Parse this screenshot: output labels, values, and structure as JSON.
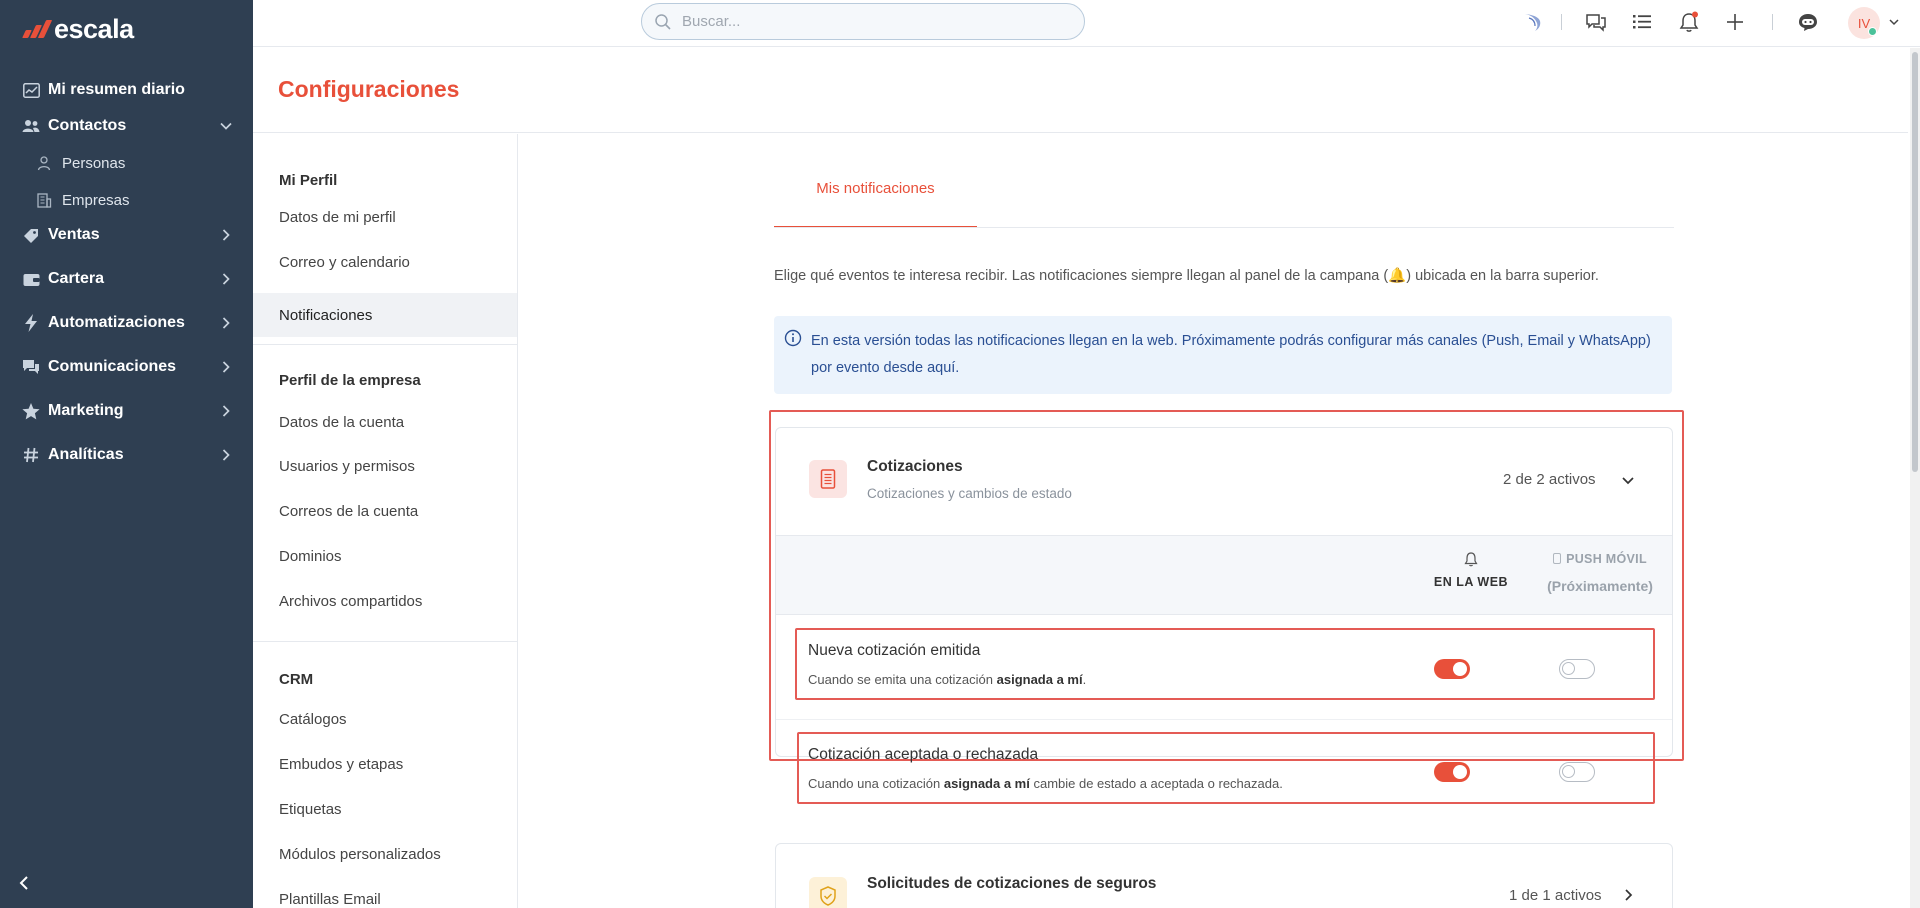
{
  "brand": {
    "name": "escala",
    "accent": "#e8503a",
    "sidebar_bg": "#2f3f52"
  },
  "sidebar": {
    "items": [
      {
        "label": "Mi resumen diario",
        "icon": "chart-line-icon"
      },
      {
        "label": "Contactos",
        "icon": "users-icon",
        "expanded": true,
        "children": [
          {
            "label": "Personas",
            "icon": "person-icon"
          },
          {
            "label": "Empresas",
            "icon": "building-icon"
          }
        ]
      },
      {
        "label": "Ventas",
        "icon": "tag-icon"
      },
      {
        "label": "Cartera",
        "icon": "wallet-icon"
      },
      {
        "label": "Automatizaciones",
        "icon": "bolt-icon"
      },
      {
        "label": "Comunicaciones",
        "icon": "chat-icon"
      },
      {
        "label": "Marketing",
        "icon": "star-icon"
      },
      {
        "label": "Analíticas",
        "icon": "hash-icon"
      }
    ]
  },
  "topbar": {
    "search_placeholder": "Buscar...",
    "avatar_initials": "IV"
  },
  "page": {
    "title": "Configuraciones"
  },
  "settings_menu": {
    "sections": [
      {
        "heading": "Mi Perfil",
        "items": [
          "Datos de mi perfil",
          "Correo y calendario",
          "Notificaciones"
        ]
      },
      {
        "heading": "Perfil de la empresa",
        "items": [
          "Datos de la cuenta",
          "Usuarios y permisos",
          "Correos de la cuenta",
          "Dominios",
          "Archivos compartidos"
        ]
      },
      {
        "heading": "CRM",
        "items": [
          "Catálogos",
          "Embudos y etapas",
          "Etiquetas",
          "Módulos personalizados",
          "Plantillas Email"
        ]
      }
    ],
    "active": "Notificaciones"
  },
  "content": {
    "tab": "Mis notificaciones",
    "intro_before": "Elige qué eventos te interesa recibir. Las notificaciones siempre llegan al panel de la campana (",
    "intro_after": ") ubicada en la barra superior.",
    "info": "En esta versión todas las notificaciones llegan en la web. Próximamente podrás configurar más canales (Push, Email y WhatsApp) por evento desde aquí.",
    "group": {
      "title": "Cotizaciones",
      "subtitle": "Cotizaciones y cambios de estado",
      "count": "2 de 2 activos",
      "col_web": "EN LA WEB",
      "col_push": "PUSH MÓVIL",
      "col_push_soon": "(Próximamente)",
      "rows": [
        {
          "title": "Nueva cotización emitida",
          "desc_before": "Cuando se emita una cotización ",
          "desc_bold": "asignada a mí",
          "desc_after": ".",
          "web": true,
          "push": false
        },
        {
          "title": "Cotización aceptada o rechazada",
          "desc_before": "Cuando una cotización ",
          "desc_bold": "asignada a mí",
          "desc_after": " cambie de estado a aceptada o rechazada.",
          "web": true,
          "push": false
        }
      ]
    },
    "group2": {
      "title": "Solicitudes de cotizaciones de seguros",
      "count": "1 de 1 activos"
    }
  }
}
